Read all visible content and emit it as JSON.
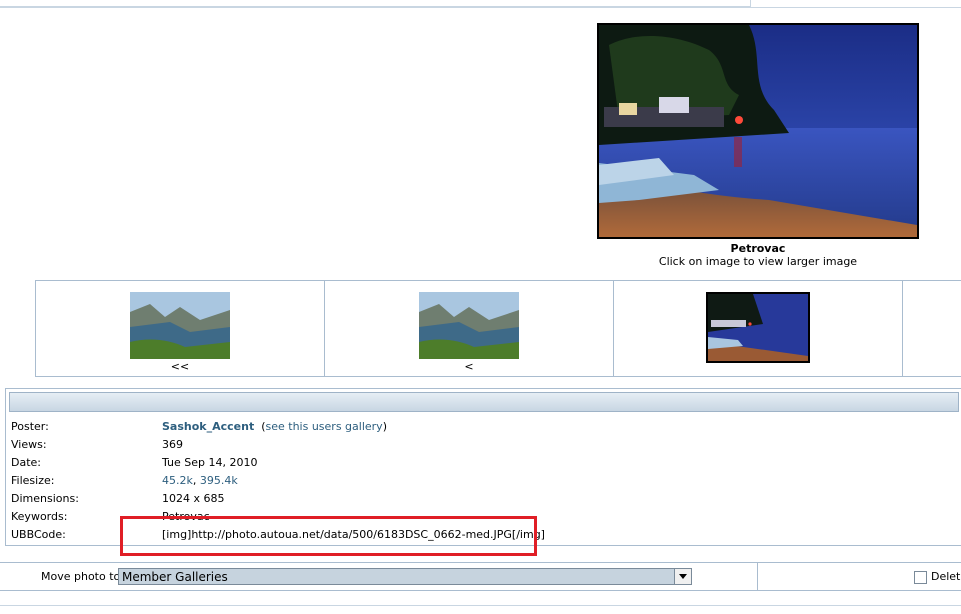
{
  "photo": {
    "title": "Petrovac",
    "hint": "Click on image to view larger image"
  },
  "thumbnails": [
    {
      "label": "<<",
      "image": "fjord-landscape"
    },
    {
      "label": "<",
      "image": "fjord-landscape"
    },
    {
      "label": "",
      "image": "petrovac-night-beach"
    }
  ],
  "details": {
    "poster_label": "Poster:",
    "poster_name": "Sashok_Accent",
    "gallery_open": "(",
    "gallery_link": "see this users gallery",
    "gallery_close": ")",
    "views_label": "Views:",
    "views_value": "369",
    "date_label": "Date:",
    "date_value": "Tue Sep 14, 2010",
    "filesize_label": "Filesize:",
    "filesize_small": "45.2k",
    "filesize_sep": ",",
    "filesize_large": "395.4k",
    "dimensions_label": "Dimensions:",
    "dimensions_value": "1024 x 685",
    "keywords_label": "Keywords:",
    "keywords_value": "Petrovac",
    "ubbcode_label": "UBBCode:",
    "ubbcode_value": "[img]http://photo.autoua.net/data/500/6183DSC_0662-med.JPG[/img]"
  },
  "move": {
    "label": "Move photo to:",
    "selected": "Member Galleries",
    "delete_label": "Delete"
  },
  "colors": {
    "link": "#2d5e7e",
    "highlight": "#e01e26",
    "border": "#a9bccf"
  }
}
